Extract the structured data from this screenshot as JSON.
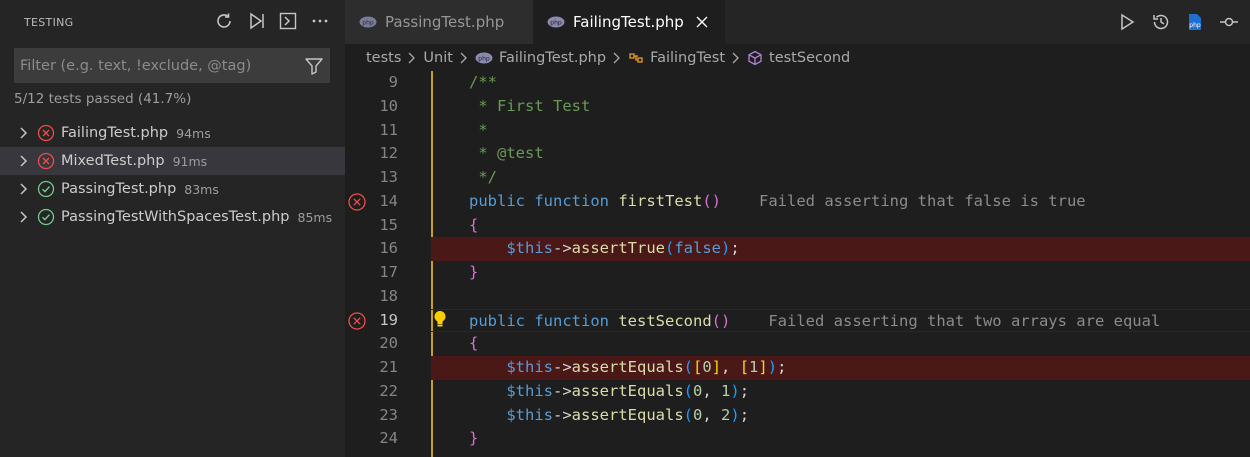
{
  "sidebar": {
    "title": "TESTING",
    "filter_placeholder": "Filter (e.g. text, !exclude, @tag)",
    "summary": "5/12 tests passed (41.7%)",
    "items": [
      {
        "name": "FailingTest.php",
        "duration": "94ms",
        "status": "failed"
      },
      {
        "name": "MixedTest.php",
        "duration": "91ms",
        "status": "failed"
      },
      {
        "name": "PassingTest.php",
        "duration": "83ms",
        "status": "passed"
      },
      {
        "name": "PassingTestWithSpacesTest.php",
        "duration": "85ms",
        "status": "passed"
      }
    ],
    "actions": [
      "refresh-icon",
      "run-all-icon",
      "debug-terminal-icon",
      "more-icon"
    ]
  },
  "tabs": [
    {
      "label": "PassingTest.php",
      "active": false
    },
    {
      "label": "FailingTest.php",
      "active": true
    }
  ],
  "breadcrumb": {
    "items": [
      "tests",
      "Unit",
      "FailingTest.php",
      "FailingTest",
      "testSecond"
    ]
  },
  "editor": {
    "annotations": {
      "line14": "Failed asserting that false is true",
      "line19": "Failed asserting that two arrays are equal"
    },
    "line_numbers": [
      "9",
      "10",
      "11",
      "12",
      "13",
      "14",
      "15",
      "16",
      "17",
      "18",
      "19",
      "20",
      "21",
      "22",
      "23",
      "24"
    ],
    "lines": {
      "l9": "/**",
      "l10": " * First Test",
      "l11": " *",
      "l12": " * @test",
      "l13": " */",
      "l14_kw1": "public",
      "l14_kw2": "function",
      "l14_fn": "firstTest",
      "l15": "{",
      "l16_this": "$this",
      "l16_arrow": "->",
      "l16_fn": "assertTrue",
      "l16_arg": "false",
      "l17": "}",
      "l19_kw1": "public",
      "l19_kw2": "function",
      "l19_fn": "testSecond",
      "l20": "{",
      "l21_fn": "assertEquals",
      "l21_a": "0",
      "l21_b": "1",
      "l22_a": "0",
      "l22_b": "1",
      "l23_a": "0",
      "l23_b": "2",
      "l24": "}"
    }
  },
  "colors": {
    "error": "#f14c4c",
    "passed": "#73c991",
    "bracket_gold": "#ffd700",
    "bracket_orchid": "#da70d6",
    "bracket_blue": "#179fff",
    "error_line_bg": "#4b1818"
  }
}
